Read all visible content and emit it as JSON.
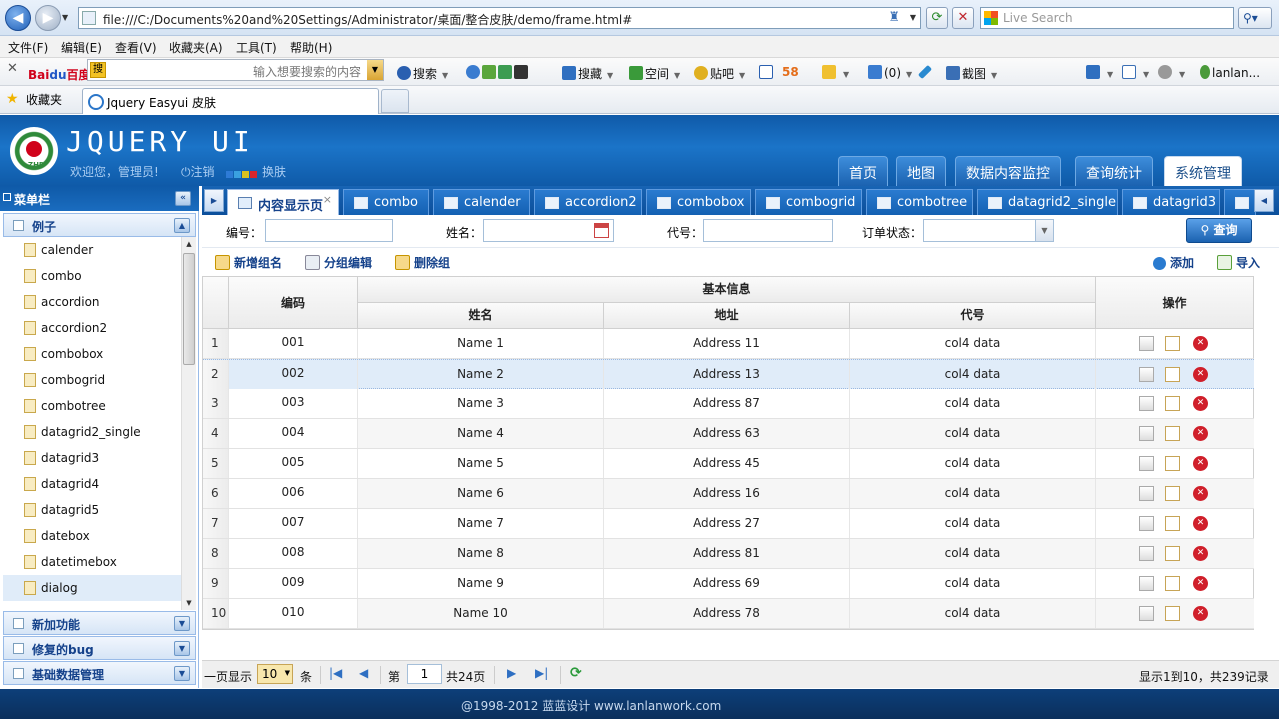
{
  "browser": {
    "url": "file:///C:/Documents%20and%20Settings/Administrator/桌面/整合皮肤/demo/frame.html#",
    "search_placeholder": "Live Search",
    "menu": [
      "文件(F)",
      "编辑(E)",
      "查看(V)",
      "收藏夹(A)",
      "工具(T)",
      "帮助(H)"
    ],
    "toolbar": {
      "baidu_placeholder": "输入想要搜索的内容",
      "search": "搜索",
      "collect": "搜藏",
      "space": "空间",
      "tieba": "贴吧",
      "num58": "58",
      "count": "(0)",
      "screenshot": "截图",
      "user": "lanlan..."
    },
    "favorites_label": "收藏夹",
    "tab_title": "Jquery Easyui 皮肤"
  },
  "header": {
    "title": "JQUERY UI",
    "welcome": "欢迎您，管理员!",
    "logout": "注销",
    "skin": "换肤",
    "skin_colors": [
      "#2e7bd6",
      "#3aa0e0",
      "#d9c21e",
      "#d8262e",
      "#c0c0c0"
    ],
    "nav": [
      "首页",
      "地图",
      "数据内容监控",
      "查询统计",
      "系统管理"
    ],
    "active_nav": "系统管理"
  },
  "sidebar": {
    "title": "菜单栏",
    "section_examples": "例子",
    "items": [
      "calender",
      "combo",
      "accordion",
      "accordion2",
      "combobox",
      "combogrid",
      "combotree",
      "datagrid2_single",
      "datagrid3",
      "datagrid4",
      "datagrid5",
      "datebox",
      "datetimebox",
      "dialog"
    ],
    "selected": "dialog",
    "sections": [
      "新加功能",
      "修复的bug",
      "基础数据管理"
    ]
  },
  "tabs": [
    "内容显示页",
    "combo",
    "calender",
    "accordion2",
    "combobox",
    "combogrid",
    "combotree",
    "datagrid2_single",
    "datagrid3"
  ],
  "search": {
    "code_label": "编号：",
    "name_label": "姓名：",
    "alias_label": "代号：",
    "status_label": "订单状态：",
    "query_button": "查询"
  },
  "actions": {
    "add_group": "新增组名",
    "edit_group": "分组编辑",
    "delete_group": "删除组",
    "add": "添加",
    "import": "导入"
  },
  "grid": {
    "col_code": "编码",
    "group_header": "基本信息",
    "col_name": "姓名",
    "col_address": "地址",
    "col_alias": "代号",
    "col_ops": "操作",
    "rows": [
      {
        "n": "1",
        "code": "001",
        "name": "Name 1",
        "address": "Address 11",
        "col4": "col4 data"
      },
      {
        "n": "2",
        "code": "002",
        "name": "Name 2",
        "address": "Address 13",
        "col4": "col4 data"
      },
      {
        "n": "3",
        "code": "003",
        "name": "Name 3",
        "address": "Address 87",
        "col4": "col4 data"
      },
      {
        "n": "4",
        "code": "004",
        "name": "Name 4",
        "address": "Address 63",
        "col4": "col4 data"
      },
      {
        "n": "5",
        "code": "005",
        "name": "Name 5",
        "address": "Address 45",
        "col4": "col4 data"
      },
      {
        "n": "6",
        "code": "006",
        "name": "Name 6",
        "address": "Address 16",
        "col4": "col4 data"
      },
      {
        "n": "7",
        "code": "007",
        "name": "Name 7",
        "address": "Address 27",
        "col4": "col4 data"
      },
      {
        "n": "8",
        "code": "008",
        "name": "Name 8",
        "address": "Address 81",
        "col4": "col4 data"
      },
      {
        "n": "9",
        "code": "009",
        "name": "Name 9",
        "address": "Address 69",
        "col4": "col4 data"
      },
      {
        "n": "10",
        "code": "010",
        "name": "Name 10",
        "address": "Address 78",
        "col4": "col4 data"
      }
    ],
    "selected_row": "2"
  },
  "pager": {
    "per_page_label": "一页显示",
    "page_size": "10",
    "unit": "条",
    "page_label": "第",
    "page_value": "1",
    "total_pages": "共24页",
    "summary": "显示1到10，共239记录"
  },
  "footer": "@1998-2012  蓝蓝设计 www.lanlanwork.com"
}
